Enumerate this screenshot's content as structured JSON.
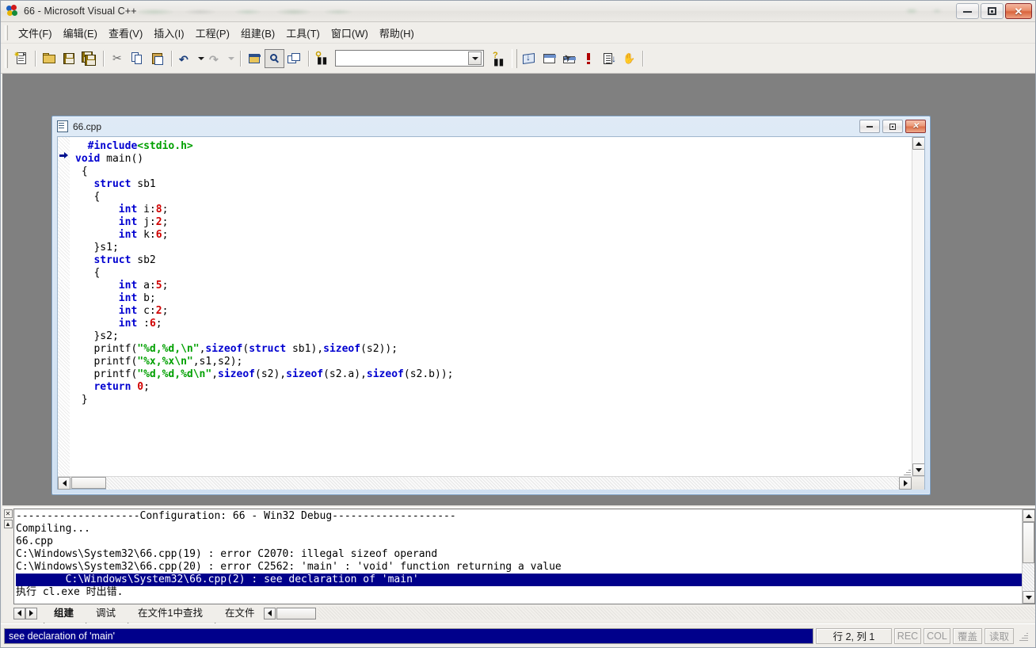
{
  "window": {
    "app_title": "66 - Microsoft Visual C++",
    "title_icon": "vcpp-logo-icon",
    "buttons": {
      "minimize": "minimize-button",
      "maximize": "maximize-button",
      "close": "close-button"
    }
  },
  "menubar": {
    "items": [
      {
        "label": "文件(F)",
        "accel": "F"
      },
      {
        "label": "编辑(E)",
        "accel": "E"
      },
      {
        "label": "查看(V)",
        "accel": "V"
      },
      {
        "label": "插入(I)",
        "accel": "I"
      },
      {
        "label": "工程(P)",
        "accel": "P"
      },
      {
        "label": "组建(B)",
        "accel": "B"
      },
      {
        "label": "工具(T)",
        "accel": "T"
      },
      {
        "label": "窗口(W)",
        "accel": "W"
      },
      {
        "label": "帮助(H)",
        "accel": "H"
      }
    ]
  },
  "toolbar": {
    "buttons": [
      "new-document-icon",
      "open-folder-icon",
      "save-icon",
      "save-all-icon",
      "cut-icon",
      "copy-icon",
      "paste-icon",
      "undo-icon",
      "redo-icon",
      "workspace-icon",
      "output-window-icon",
      "window-list-icon",
      "find-in-files-icon"
    ],
    "combo_value": "",
    "combo_placeholder": "",
    "right_buttons": [
      "find-help-icon",
      "compile-icon",
      "build-icon",
      "build-execute-icon",
      "stop-build-icon",
      "execute-program-icon",
      "go-icon"
    ]
  },
  "editor_window": {
    "title": "66.cpp",
    "icon": "cpp-document-icon",
    "buttons": {
      "minimize": "restore-down-button",
      "maximize": "maximize-button",
      "close": "close-button"
    },
    "current_line_marker": 2,
    "code_lines": [
      [
        {
          "t": "  ",
          "c": "fn"
        },
        {
          "t": "#include",
          "c": "pp"
        },
        {
          "t": "<stdio.h>",
          "c": "pph"
        }
      ],
      [
        {
          "t": "",
          "c": "fn"
        },
        {
          "t": "void",
          "c": "kw"
        },
        {
          "t": " main()",
          "c": "fn"
        }
      ],
      [
        {
          "t": " {",
          "c": "fn"
        }
      ],
      [
        {
          "t": "   ",
          "c": "fn"
        },
        {
          "t": "struct",
          "c": "kw"
        },
        {
          "t": " sb1",
          "c": "fn"
        }
      ],
      [
        {
          "t": "   {",
          "c": "fn"
        }
      ],
      [
        {
          "t": "       ",
          "c": "fn"
        },
        {
          "t": "int",
          "c": "kw"
        },
        {
          "t": " i:",
          "c": "fn"
        },
        {
          "t": "8",
          "c": "num"
        },
        {
          "t": ";",
          "c": "fn"
        }
      ],
      [
        {
          "t": "       ",
          "c": "fn"
        },
        {
          "t": "int",
          "c": "kw"
        },
        {
          "t": " j:",
          "c": "fn"
        },
        {
          "t": "2",
          "c": "num"
        },
        {
          "t": ";",
          "c": "fn"
        }
      ],
      [
        {
          "t": "       ",
          "c": "fn"
        },
        {
          "t": "int",
          "c": "kw"
        },
        {
          "t": " k:",
          "c": "fn"
        },
        {
          "t": "6",
          "c": "num"
        },
        {
          "t": ";",
          "c": "fn"
        }
      ],
      [
        {
          "t": "   }s1;",
          "c": "fn"
        }
      ],
      [
        {
          "t": "   ",
          "c": "fn"
        },
        {
          "t": "struct",
          "c": "kw"
        },
        {
          "t": " sb2",
          "c": "fn"
        }
      ],
      [
        {
          "t": "   {",
          "c": "fn"
        }
      ],
      [
        {
          "t": "       ",
          "c": "fn"
        },
        {
          "t": "int",
          "c": "kw"
        },
        {
          "t": " a:",
          "c": "fn"
        },
        {
          "t": "5",
          "c": "num"
        },
        {
          "t": ";",
          "c": "fn"
        }
      ],
      [
        {
          "t": "       ",
          "c": "fn"
        },
        {
          "t": "int",
          "c": "kw"
        },
        {
          "t": " b;",
          "c": "fn"
        }
      ],
      [
        {
          "t": "       ",
          "c": "fn"
        },
        {
          "t": "int",
          "c": "kw"
        },
        {
          "t": " c:",
          "c": "fn"
        },
        {
          "t": "2",
          "c": "num"
        },
        {
          "t": ";",
          "c": "fn"
        }
      ],
      [
        {
          "t": "       ",
          "c": "fn"
        },
        {
          "t": "int",
          "c": "kw"
        },
        {
          "t": " :",
          "c": "fn"
        },
        {
          "t": "6",
          "c": "num"
        },
        {
          "t": ";",
          "c": "fn"
        }
      ],
      [
        {
          "t": "   }s2;",
          "c": "fn"
        }
      ],
      [
        {
          "t": "   printf(",
          "c": "fn"
        },
        {
          "t": "\"%d,%d,\\n\"",
          "c": "str"
        },
        {
          "t": ",",
          "c": "fn"
        },
        {
          "t": "sizeof",
          "c": "kw"
        },
        {
          "t": "(",
          "c": "fn"
        },
        {
          "t": "struct",
          "c": "kw"
        },
        {
          "t": " sb1),",
          "c": "fn"
        },
        {
          "t": "sizeof",
          "c": "kw"
        },
        {
          "t": "(s2));",
          "c": "fn"
        }
      ],
      [
        {
          "t": "   printf(",
          "c": "fn"
        },
        {
          "t": "\"%x,%x\\n\"",
          "c": "str"
        },
        {
          "t": ",s1,s2);",
          "c": "fn"
        }
      ],
      [
        {
          "t": "   printf(",
          "c": "fn"
        },
        {
          "t": "\"%d,%d,%d\\n\"",
          "c": "str"
        },
        {
          "t": ",",
          "c": "fn"
        },
        {
          "t": "sizeof",
          "c": "kw"
        },
        {
          "t": "(s2),",
          "c": "fn"
        },
        {
          "t": "sizeof",
          "c": "kw"
        },
        {
          "t": "(s2.a),",
          "c": "fn"
        },
        {
          "t": "sizeof",
          "c": "kw"
        },
        {
          "t": "(s2.b));",
          "c": "fn"
        }
      ],
      [
        {
          "t": "   ",
          "c": "fn"
        },
        {
          "t": "return",
          "c": "kw"
        },
        {
          "t": " ",
          "c": "fn"
        },
        {
          "t": "0",
          "c": "num"
        },
        {
          "t": ";",
          "c": "fn"
        }
      ],
      [
        {
          "t": " }",
          "c": "fn"
        }
      ]
    ]
  },
  "output_window": {
    "lines": [
      {
        "text": "--------------------Configuration: 66 - Win32 Debug--------------------",
        "selected": false
      },
      {
        "text": "Compiling...",
        "selected": false
      },
      {
        "text": "66.cpp",
        "selected": false
      },
      {
        "text": "C:\\Windows\\System32\\66.cpp(19) : error C2070: illegal sizeof operand",
        "selected": false
      },
      {
        "text": "C:\\Windows\\System32\\66.cpp(20) : error C2562: 'main' : 'void' function returning a value",
        "selected": false
      },
      {
        "text": "        C:\\Windows\\System32\\66.cpp(2) : see declaration of 'main'",
        "selected": true
      },
      {
        "text": "执行 cl.exe 时出错.",
        "selected": false
      }
    ],
    "tabs": [
      {
        "label": "组建",
        "active": true
      },
      {
        "label": "调试",
        "active": false
      },
      {
        "label": "在文件1中查找",
        "active": false
      },
      {
        "label": "在文件",
        "active": false
      }
    ]
  },
  "statusbar": {
    "message": "see declaration of 'main'",
    "position": "行 2, 列 1",
    "indicators": [
      {
        "label": "REC",
        "enabled": false
      },
      {
        "label": "COL",
        "enabled": false
      },
      {
        "label": "覆盖",
        "enabled": false
      },
      {
        "label": "读取",
        "enabled": false
      }
    ]
  },
  "colors": {
    "keyword": "#0000d0",
    "string": "#00a000",
    "number": "#d00000",
    "selection_bg": "#00008b",
    "child_window_title": "#cfe0f2"
  }
}
